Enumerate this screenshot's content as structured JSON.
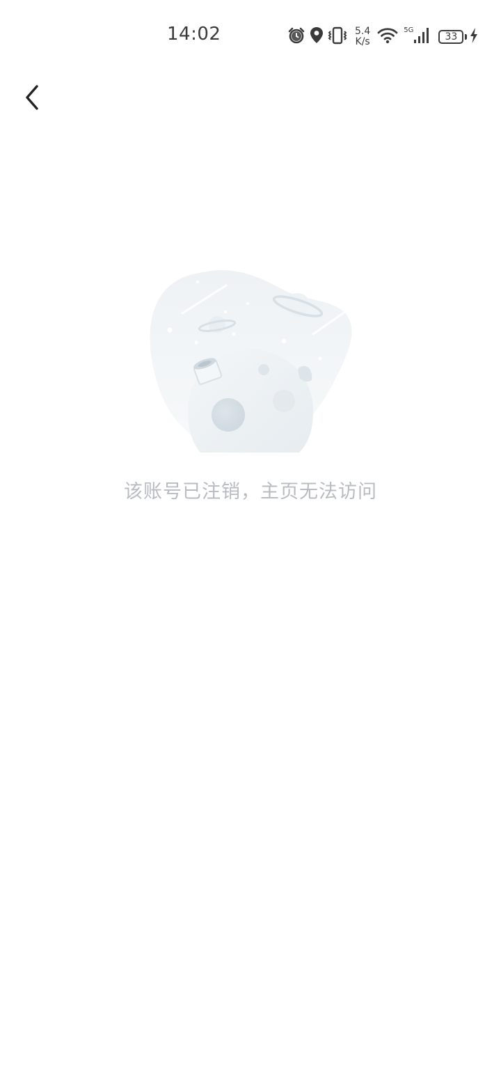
{
  "status_bar": {
    "time": "14:02",
    "net_speed_value": "5.4",
    "net_speed_unit": "K/s",
    "network_type": "5G",
    "battery_level": "33",
    "icons": [
      "alarm-icon",
      "location-icon",
      "vibrate-icon",
      "wifi-icon",
      "signal-icon",
      "battery-icon",
      "charging-icon"
    ]
  },
  "nav": {
    "back_icon": "chevron-left-icon"
  },
  "empty_state": {
    "illustration": "planet-space-illustration",
    "message": "该账号已注销，主页无法访问"
  },
  "colors": {
    "background": "#ffffff",
    "message_text": "#b8bcc2",
    "status_text": "#3a3a3a",
    "back_icon": "#222222"
  }
}
